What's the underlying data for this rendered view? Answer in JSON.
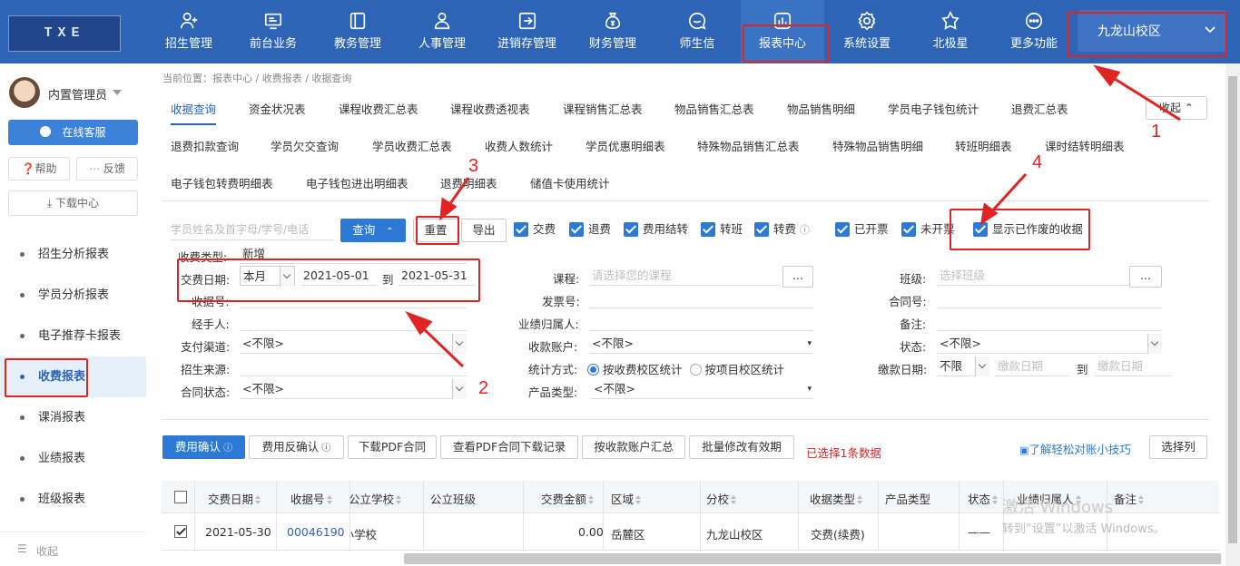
{
  "logo": {
    "text": "TXE"
  },
  "nav": [
    {
      "label": "招生管理",
      "icon": "user-plus-icon"
    },
    {
      "label": "前台业务",
      "icon": "monitor-icon"
    },
    {
      "label": "教务管理",
      "icon": "book-icon"
    },
    {
      "label": "人事管理",
      "icon": "person-icon"
    },
    {
      "label": "进销存管理",
      "icon": "exit-box-icon"
    },
    {
      "label": "财务管理",
      "icon": "money-bag-icon"
    },
    {
      "label": "师生信",
      "icon": "chat-bubble-icon"
    },
    {
      "label": "报表中心",
      "icon": "bar-chart-icon"
    },
    {
      "label": "系统设置",
      "icon": "gear-icon"
    },
    {
      "label": "北极星",
      "icon": "star-icon"
    },
    {
      "label": "更多功能",
      "icon": "more-icon"
    }
  ],
  "campus": {
    "label": "九龙山校区"
  },
  "user": {
    "name": "内置管理员"
  },
  "side": {
    "service": "在线客服",
    "help": "帮助",
    "feedback": "反馈",
    "download": "下载中心",
    "menu": [
      "招生分析报表",
      "学员分析报表",
      "电子推荐卡报表",
      "收费报表",
      "课消报表",
      "业绩报表",
      "班级报表"
    ],
    "collapse": "收起"
  },
  "breadcrumb": "当前位置：报表中心 / 收费报表 / 收据查询",
  "tabs": {
    "row1": [
      "收据查询",
      "资金状况表",
      "课程收费汇总表",
      "课程收费透视表",
      "课程销售汇总表",
      "物品销售汇总表",
      "物品销售明细",
      "学员电子钱包统计",
      "退费汇总表"
    ],
    "row2": [
      "退费扣款查询",
      "学员欠交查询",
      "学员收费汇总表",
      "收费人数统计",
      "学员优惠明细表",
      "特殊物品销售汇总表",
      "特殊物品销售明细",
      "转班明细表",
      "课时结转明细表"
    ],
    "row3": [
      "电子钱包转费明细表",
      "电子钱包进出明细表",
      "退费明细表",
      "储值卡使用统计"
    ],
    "fold": "收起"
  },
  "toolbar": {
    "search_placeholder": "学员姓名及首字母/学号/电话",
    "query": "查询",
    "reset": "重置",
    "export": "导出",
    "checks": [
      "交费",
      "退费",
      "费用结转",
      "转班",
      "转费",
      "已开票",
      "未开票",
      "显示已作废的收据"
    ]
  },
  "form": {
    "fee_type_label": "收费类型:",
    "fee_type_value": "新增",
    "date_label": "交费日期:",
    "date_period": "本月",
    "date_from": "2021-05-01",
    "date_to_label": "到",
    "date_to": "2021-05-31",
    "receipt_label": "收据号:",
    "handler_label": "经手人:",
    "payment_label": "支付渠道:",
    "payment_value": "<不限>",
    "source_label": "招生来源:",
    "contract_label": "合同状态:",
    "contract_value": "<不限>",
    "course_label": "课程:",
    "course_placeholder": "请选择您的课程",
    "invoice_label": "发票号:",
    "perf_label": "业绩归属人:",
    "account_label": "收款账户:",
    "account_value": "<不限>",
    "stat_label": "统计方式:",
    "stat_opt1": "按收费校区统计",
    "stat_opt2": "按项目校区统计",
    "product_label": "产品类型:",
    "product_value": "<不限>",
    "class_label": "班级:",
    "class_placeholder": "选择班级",
    "contract_no_label": "合同号:",
    "remark_label": "备注:",
    "status_label": "状态:",
    "status_value": "<不限>",
    "paydate_label": "缴款日期:",
    "paydate_value": "不限",
    "paydate_ph": "缴款日期",
    "paydate_to": "到",
    "paydate_ph2": "缴款日期",
    "ellipsis": "..."
  },
  "actions": {
    "confirm": "费用确认",
    "unconfirm": "费用反确认",
    "download_pdf": "下载PDF合同",
    "view_pdf": "查看PDF合同下载记录",
    "by_account": "按收款账户汇总",
    "batch": "批量修改有效期",
    "selected": "已选择1条数据",
    "tip": "了解轻松对账小技巧",
    "columns": "选择列"
  },
  "table": {
    "headers": [
      "交费日期",
      "收据号",
      "公立学校",
      "公立班级",
      "交费金额",
      "区域",
      "分校",
      "收据类型",
      "产品类型",
      "状态",
      "业绩归属人",
      "备注"
    ],
    "rows": [
      {
        "date": "2021-05-30",
        "receipt": "00046190",
        "school": "小学校",
        "class": "",
        "amount": "0.00",
        "region": "岳麓区",
        "branch": "九龙山校区",
        "type": "交费(续费)",
        "product": "",
        "status": "——",
        "perf": "",
        "remark": ""
      }
    ]
  },
  "watermark": {
    "line1": "激活 Windows",
    "line2": "转到“设置”以激活 Windows。"
  },
  "annotations": [
    "1",
    "2",
    "3",
    "4"
  ],
  "colors": {
    "primary": "#2d64b6",
    "accent": "#2d7ad6",
    "annotation": "#e02424"
  }
}
